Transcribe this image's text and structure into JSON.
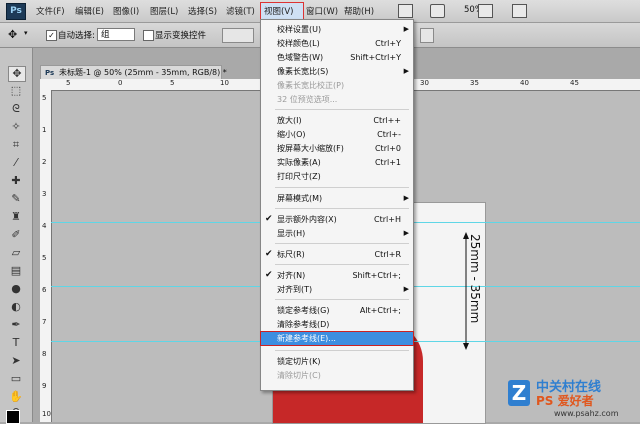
{
  "app": {
    "logo": "Ps"
  },
  "menubar": {
    "items": [
      "文件(F)",
      "编辑(E)",
      "图像(I)",
      "图层(L)",
      "选择(S)",
      "滤镜(T)",
      "视图(V)",
      "窗口(W)",
      "帮助(H)"
    ],
    "zoom": "50%"
  },
  "options": {
    "auto_select_label": "自动选择:",
    "auto_select_value": "组",
    "show_transform_label": "显示变换控件"
  },
  "document": {
    "tab_title": "未标题-1 @ 50% (25mm - 35mm, RGB/8) *",
    "ruler_top": [
      "5",
      "0",
      "5",
      "10",
      "15",
      "20",
      "25",
      "30",
      "35",
      "40",
      "45"
    ],
    "ruler_left": [
      "5",
      "1",
      "2",
      "3",
      "4",
      "5",
      "6",
      "7",
      "8",
      "9",
      "10"
    ],
    "dimension_label": "25mm - 35mm"
  },
  "view_menu": {
    "items": [
      {
        "label": "校样设置(U)",
        "shortcut": "",
        "submenu": true
      },
      {
        "label": "校样颜色(L)",
        "shortcut": "Ctrl+Y"
      },
      {
        "label": "色域警告(W)",
        "shortcut": "Shift+Ctrl+Y"
      },
      {
        "label": "像素长宽比(S)",
        "shortcut": "",
        "submenu": true
      },
      {
        "label": "像素长宽比校正(P)",
        "shortcut": "",
        "disabled": true
      },
      {
        "label": "32 位预览选项...",
        "shortcut": "",
        "disabled": true
      },
      {
        "label": "放大(I)",
        "shortcut": "Ctrl++"
      },
      {
        "label": "缩小(O)",
        "shortcut": "Ctrl+-"
      },
      {
        "label": "按屏幕大小缩放(F)",
        "shortcut": "Ctrl+0"
      },
      {
        "label": "实际像素(A)",
        "shortcut": "Ctrl+1"
      },
      {
        "label": "打印尺寸(Z)",
        "shortcut": ""
      },
      {
        "label": "屏幕模式(M)",
        "shortcut": "",
        "submenu": true
      },
      {
        "label": "显示额外内容(X)",
        "shortcut": "Ctrl+H",
        "checked": true
      },
      {
        "label": "显示(H)",
        "shortcut": "",
        "submenu": true
      },
      {
        "label": "标尺(R)",
        "shortcut": "Ctrl+R",
        "checked": true
      },
      {
        "label": "对齐(N)",
        "shortcut": "Shift+Ctrl+;",
        "checked": true
      },
      {
        "label": "对齐到(T)",
        "shortcut": "",
        "submenu": true
      },
      {
        "label": "锁定参考线(G)",
        "shortcut": "Alt+Ctrl+;"
      },
      {
        "label": "清除参考线(D)",
        "shortcut": ""
      },
      {
        "label": "新建参考线(E)...",
        "shortcut": "",
        "highlighted": true
      },
      {
        "label": "锁定切片(K)",
        "shortcut": ""
      },
      {
        "label": "清除切片(C)",
        "shortcut": "",
        "disabled": true
      }
    ]
  },
  "watermark": {
    "line1": "中关村在线",
    "line2": "PS 爱好者",
    "url": "www.psahz.com"
  },
  "colors": {
    "guide": "#5fd6e6",
    "highlight": "#3d8ee0",
    "jacket": "#c62828"
  }
}
